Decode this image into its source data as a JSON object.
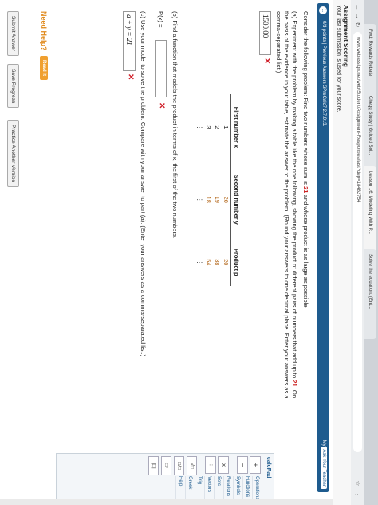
{
  "browser": {
    "tabs": [
      "Fwd: Rewards Rebate",
      "Chegg Study | Guided Sol...",
      "Lesson 16: Modeling With P...",
      "Solve the equation. (Ent..."
    ],
    "url": "www.webassign.net/web/Student/Assignment-Responses/last?dep=18482754"
  },
  "header": {
    "title": "Assignment Scoring",
    "subtitle": "Your last submission is used for your score."
  },
  "question": {
    "number": "1.",
    "points_line": "0/3 points  |  Previous Answers  SPreCalc7 2.7.013.",
    "my_notes": "My Notes",
    "ask_teacher": "Ask Your Teacher",
    "prompt_pre": "Consider the following problem: Find two numbers whose sum is ",
    "sum_value": "21",
    "prompt_post": " and whose product is as large as possible.",
    "part_a_line1_pre": "(a) Experiment with the problem by making a table like the one following, showing the product of different pairs of numbers that add up to ",
    "part_a_sum": "21",
    "part_a_line1_post": ". On",
    "part_a_line2": "the basis of the evidence in your table, estimate the answer to the problem. (Round your answers to one decimal place. Enter your answers as a",
    "part_a_line3": "comma-separated list.)",
    "answer_a": "1500.00",
    "table": {
      "headers": [
        "First number x",
        "Second number y",
        "Product p"
      ],
      "rows": [
        [
          "1",
          "20",
          "20"
        ],
        [
          "2",
          "19",
          "38"
        ],
        [
          "3",
          "18",
          "54"
        ],
        [
          "⋮",
          "⋮",
          "⋮"
        ]
      ]
    },
    "part_b": "(b) Find a function that models the product in terms of x, the first of the two numbers.",
    "px_label": "P(x) =",
    "part_c": "(c) Use your model to solve the problem. Compare with your answer to part (a). (Enter your answers as a comma-separated list.)",
    "answer_c": "a + y = 21",
    "need_help": "Need Help?",
    "read_it": "Read It",
    "buttons": [
      "Submit Answer",
      "Save Progress",
      "Practice Another Version"
    ]
  },
  "mathpad": {
    "title": "calcPad",
    "top_keys": [
      "+",
      "−"
    ],
    "ops": [
      "×",
      "÷"
    ],
    "items": [
      "Operations",
      "Functions",
      "Symbols",
      "Relations",
      "Sets",
      "Vectors",
      "Trig",
      "Greek",
      "Help"
    ],
    "keys": [
      "√□",
      "□/□",
      "□ⁿ",
      "|□|"
    ]
  }
}
